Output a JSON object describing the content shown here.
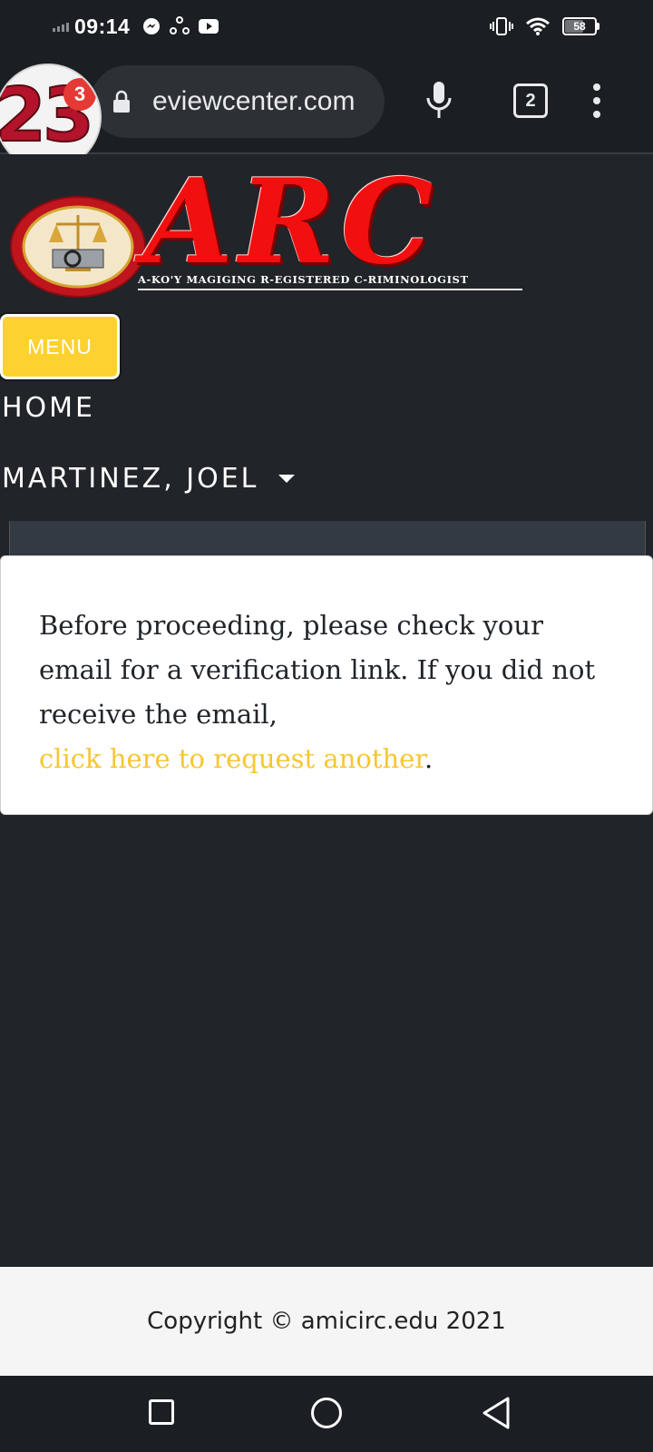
{
  "status_bar": {
    "time": "09:14",
    "battery": "58",
    "icons": [
      "signal-icon",
      "messenger-icon",
      "sync-icon",
      "youtube-icon",
      "vibrate-icon",
      "wifi-icon",
      "battery-icon"
    ]
  },
  "browser": {
    "url": "eviewcenter.com",
    "tab_count": "2",
    "avatar_text": "23",
    "notification_count": "3"
  },
  "site": {
    "logo_title": "ARC",
    "logo_tagline": "A-KO'Y MAGIGING R-EGISTERED C-RIMINOLOGIST",
    "menu_label": "MENU",
    "nav": {
      "home": "HOME",
      "user": "MARTINEZ, JOEL"
    }
  },
  "card": {
    "message": "Before proceeding, please check your email for a verification link. If you did not receive the email,",
    "link_text": "click here to request another",
    "link_suffix": "."
  },
  "footer": {
    "copyright": "Copyright © amicirc.edu 2021"
  },
  "colors": {
    "page_bg": "#212429",
    "menu_button": "#fdd12f",
    "link": "#f7c632",
    "logo_red": "#f20f0f",
    "badge_red": "#e53935"
  }
}
